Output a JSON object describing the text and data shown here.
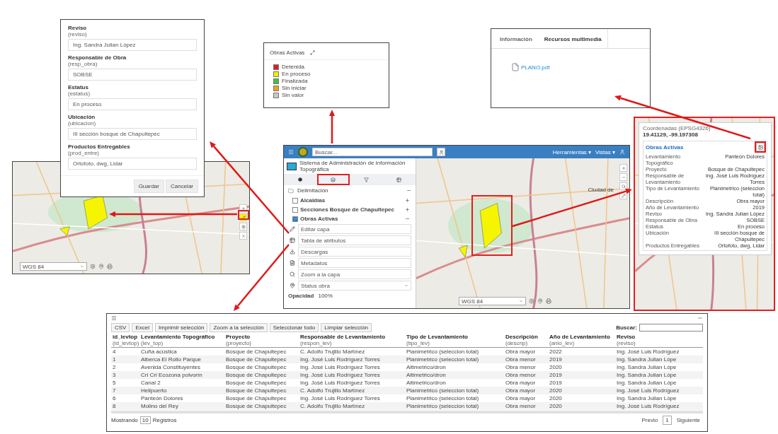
{
  "edit_form": {
    "fields": [
      {
        "label": "Reviso",
        "field": "(reviso)",
        "value": "Ing. Sandra Julian López"
      },
      {
        "label": "Responsable de Obra",
        "field": "(resp_obra)",
        "value": "SOBSE"
      },
      {
        "label": "Estatus",
        "field": "(estatus)",
        "value": "En proceso"
      },
      {
        "label": "Ubicación",
        "field": "(ubicacion)",
        "value": "III sección bosque de Chapultepec"
      },
      {
        "label": "Productos Entregables",
        "field": "(prod_entre)",
        "value": "Ortofoto, dwg, Lidar"
      }
    ],
    "buttons": [
      "Guardar",
      "Cancelar"
    ]
  },
  "left_map": {
    "projection": "WGS 84"
  },
  "legend": {
    "title": "Obras Activas",
    "items": [
      {
        "label": "Detenida",
        "color": "#e02020"
      },
      {
        "label": "En proceso",
        "color": "#f0f000"
      },
      {
        "label": "Finalizada",
        "color": "#40c040"
      },
      {
        "label": "Sin iniciar",
        "color": "#f0a020"
      },
      {
        "label": "Sin valor",
        "color": "#c8c8c8"
      }
    ]
  },
  "info_panel": {
    "tabs": [
      {
        "label": "Información",
        "selected": false
      },
      {
        "label": "Recursos multimedia",
        "selected": true
      }
    ],
    "file": "PLANO.pdf"
  },
  "popup": {
    "title": "Coordenadas (EPSG4326)",
    "coords": "19.41129, -99.197308",
    "layer": "Obras Activas",
    "rows": [
      {
        "key": "Levantamiento Topográfico",
        "value": "Panteón Dolores"
      },
      {
        "key": "Proyecto",
        "value": "Bosque de Chapultepec"
      },
      {
        "key": "Responsable de Levantamiento",
        "value": "Ing. José Luis Rodríguez Torres"
      },
      {
        "key": "Tipo de Levantamiento",
        "value": "Planimetrico (seleccion total)"
      },
      {
        "key": "Descripción",
        "value": "Obra mayor"
      },
      {
        "key": "Año de Levantamiento",
        "value": "2019"
      },
      {
        "key": "Reviso",
        "value": "Ing. Sandra Julian López"
      },
      {
        "key": "Responsable de Obra",
        "value": "SOBSE"
      },
      {
        "key": "Estatus",
        "value": "En proceso"
      },
      {
        "key": "Ubicación",
        "value": "III sección bosque de Chapultepec"
      },
      {
        "key": "Productos Entregables",
        "value": "Ortofoto, dwg, Lidar"
      }
    ]
  },
  "app": {
    "search_placeholder": "Buscar...",
    "menus": [
      "Herramientas ▾",
      "Vistas ▾"
    ],
    "title": "Sistema de Administración de Información Topográfica",
    "group": "Delimitación",
    "layers": [
      {
        "name": "Alcaldías",
        "checked": false,
        "expanded": false
      },
      {
        "name": "Secciones Bosque de Chapultepec",
        "checked": false,
        "expanded": false
      },
      {
        "name": "Obras Activas",
        "checked": true,
        "expanded": true
      }
    ],
    "tools": [
      "Editar capa",
      "Tabla de atributos",
      "Descargas",
      "Metadatos",
      "Zoom a la capa"
    ],
    "status_select": "Status obra",
    "opacity_label": "Opacidad",
    "opacity_value": "100%",
    "projection": "WGS 84",
    "map_label": "Ciudad de"
  },
  "table": {
    "buttons": [
      "CSV",
      "Excel",
      "Imprimir selección",
      "Zoom a la selección",
      "Seleccionar todo",
      "Limpiar selección"
    ],
    "search_label": "Buscar:",
    "columns": [
      {
        "title": "id_levtop",
        "field": "(id_levtop)"
      },
      {
        "title": "Levantamiento Topográfico",
        "field": "(lev_top)"
      },
      {
        "title": "Proyecto",
        "field": "(proyecto)"
      },
      {
        "title": "Responsable de Levantamiento",
        "field": "(respon_lev)"
      },
      {
        "title": "Tipo de Levantamiento",
        "field": "(tipo_lev)"
      },
      {
        "title": "Descripción",
        "field": "(descrip)"
      },
      {
        "title": "Año de Levantamiento",
        "field": "(anio_lev)"
      },
      {
        "title": "Reviso",
        "field": "(reviso)"
      }
    ],
    "rows": [
      [
        "4",
        "Cuña acústica",
        "Bosque de Chapultepec",
        "C. Adolfo Trujillo Martínez",
        "Planimetrico (seleccion total)",
        "Obra mayor",
        "2022",
        "Ing. José Luis Rodríguez"
      ],
      [
        "1",
        "Alberca El Rollo Parque",
        "Bosque de Chapultepec",
        "Ing. José Luis Rodríguez Torres",
        "Planimetrico (seleccion total)",
        "Obra menor",
        "2019",
        "Ing. Sandra Julian Lópe"
      ],
      [
        "2",
        "Avenida Constituyentes",
        "Bosque de Chapultepec",
        "Ing. José Luis Rodríguez Torres",
        "Altimetrico/dron",
        "Obra menor",
        "2020",
        "Ing. Sandra Julian Lópe"
      ],
      [
        "3",
        "Cri Cri Ecozona polvorín",
        "Bosque de Chapultepec",
        "Ing. José Luis Rodríguez Torres",
        "Altimetrico/dron",
        "Obra menor",
        "2019",
        "Ing. Sandra Julian Lópe"
      ],
      [
        "5",
        "Canal 2",
        "Bosque de Chapultepec",
        "Ing. José Luis Rodríguez Torres",
        "Altimetrico/dron",
        "Obra mayor",
        "2019",
        "Ing. Sandra Julian Lópe"
      ],
      [
        "7",
        "Helipuerto",
        "Bosque de Chapultepec",
        "C. Adolfo Trujillo Martínez",
        "Planimetrico (seleccion total)",
        "Obra mayor",
        "2020",
        "Ing. José Luis Rodríguez"
      ],
      [
        "6",
        "Panteón Dolores",
        "Bosque de Chapultepec",
        "Ing. José Luis Rodríguez Torres",
        "Planimetrico (seleccion total)",
        "Obra mayor",
        "2020",
        "Ing. Sandra Julian Lópe"
      ],
      [
        "8",
        "Molino del Rey",
        "Bosque de Chapultepec",
        "C. Adolfo Trujillo Martínez",
        "Planimetrico (seleccion total)",
        "Obra menor",
        "2020",
        "Ing. José Luis Rodríguez"
      ]
    ],
    "footer_left": "Mostrando",
    "page_size": "10",
    "footer_right": "Registros",
    "prev": "Previo",
    "page": "1",
    "next": "Siguiente"
  }
}
